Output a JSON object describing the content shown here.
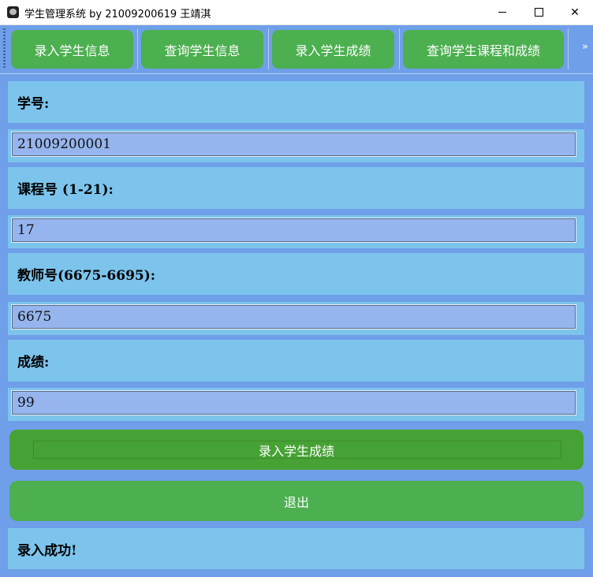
{
  "window": {
    "title": "学生管理系统 by 21009200619 王靖淇",
    "minimize": "—",
    "maximize": "☐",
    "close": "✕"
  },
  "toolbar": {
    "buttons": [
      "录入学生信息",
      "查询学生信息",
      "录入学生成绩",
      "查询学生课程和成绩"
    ],
    "more": "»"
  },
  "form": {
    "student_id_label": "学号:",
    "student_id_value": "21009200001",
    "course_label": "课程号 (1-21):",
    "course_value": "17",
    "teacher_label": "教师号(6675-6695):",
    "teacher_value": "6675",
    "score_label": "成绩:",
    "score_value": "99"
  },
  "actions": {
    "submit": "录入学生成绩",
    "exit": "退出"
  },
  "status": {
    "message": "录入成功!"
  }
}
